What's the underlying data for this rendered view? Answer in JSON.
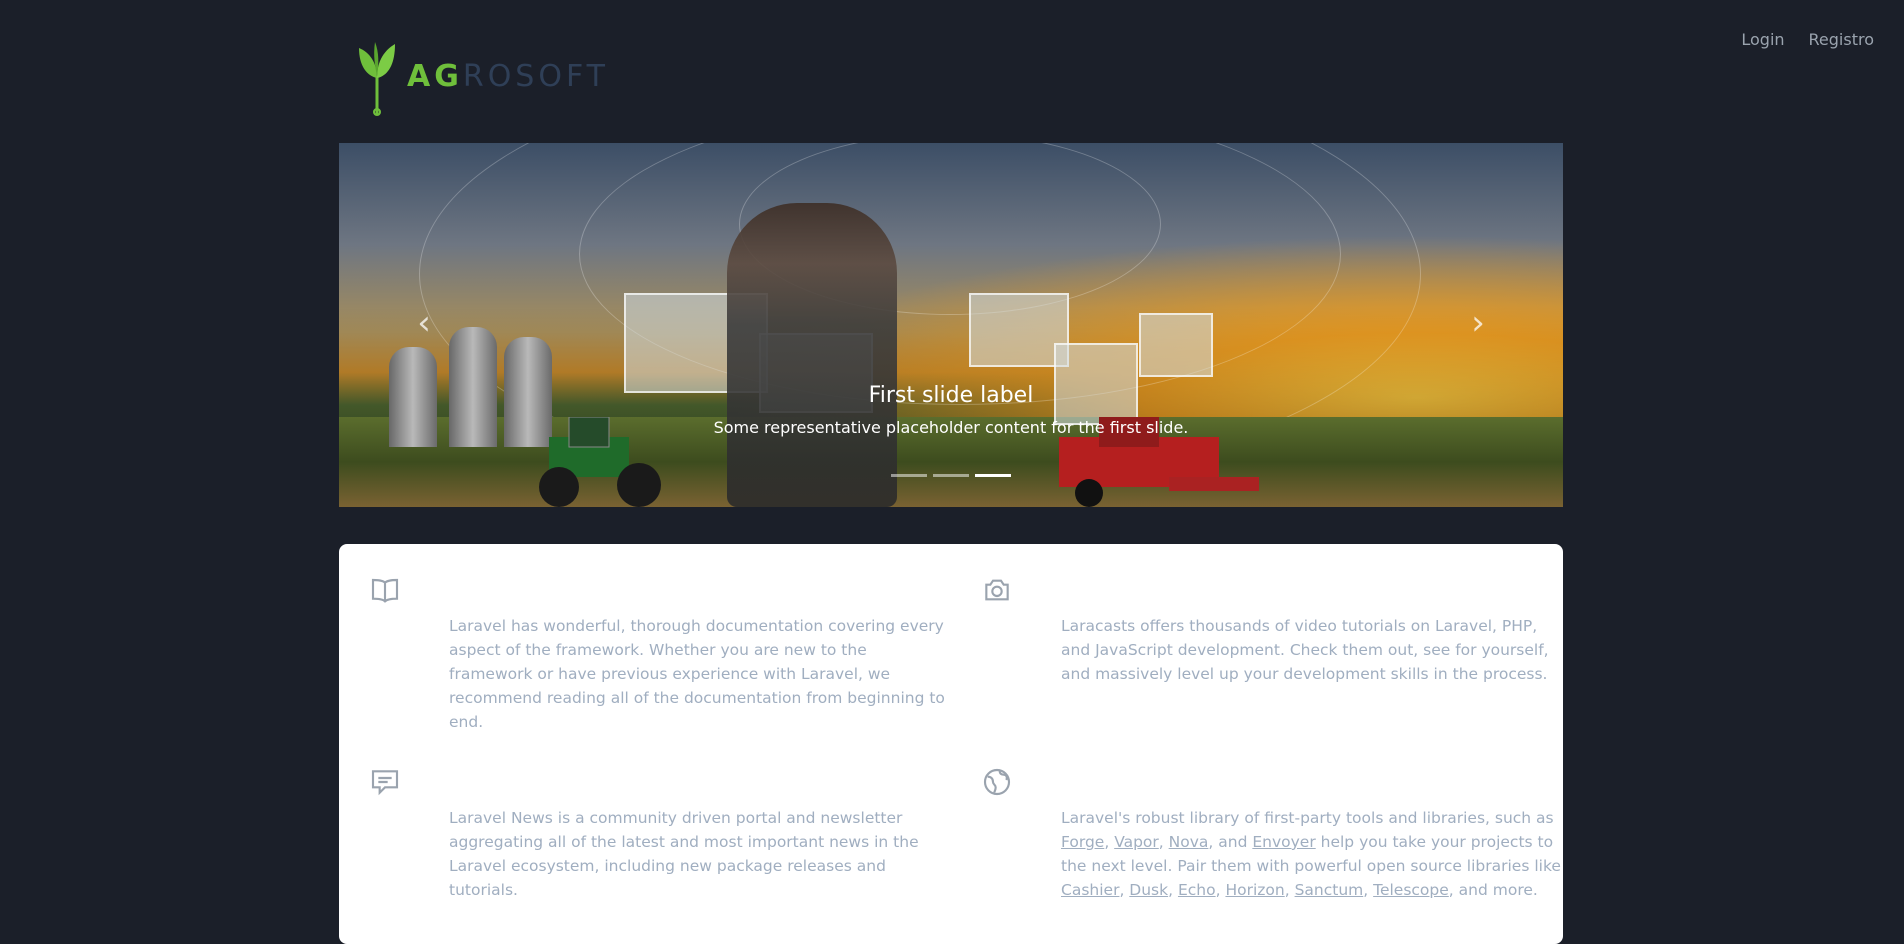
{
  "nav": {
    "login": "Login",
    "register": "Registro"
  },
  "logo": {
    "accent": "AG",
    "rest": "ROSOFT",
    "accent_color": "#6fbf3b"
  },
  "carousel": {
    "caption_title": "First slide label",
    "caption_text": "Some representative placeholder content for the first slide.",
    "prev_label": "‹",
    "next_label": "›",
    "slides": 3,
    "active_slide": 3
  },
  "features": [
    {
      "icon": "book-icon",
      "text": "Laravel has wonderful, thorough documentation covering every aspect of the framework. Whether you are new to the framework or have previous experience with Laravel, we recommend reading all of the documentation from beginning to end."
    },
    {
      "icon": "camera-icon",
      "text": "Laracasts offers thousands of video tutorials on Laravel, PHP, and JavaScript development. Check them out, see for yourself, and massively level up your development skills in the process."
    },
    {
      "icon": "chat-icon",
      "text": "Laravel News is a community driven portal and newsletter aggregating all of the latest and most important news in the Laravel ecosystem, including new package releases and tutorials."
    },
    {
      "icon": "globe-icon",
      "text_intro": "Laravel's robust library of first-party tools and libraries, such as",
      "links_a": [
        "Forge",
        "Vapor",
        "Nova"
      ],
      "and_1": ", and",
      "link_envoyer": "Envoyer",
      "text_mid": "help you take your projects to the next level. Pair them with powerful open source libraries like",
      "links_b": [
        "Cashier",
        "Dusk",
        "Echo",
        "Horizon",
        "Sanctum",
        "Telescope"
      ],
      "text_end": ", and more."
    }
  ]
}
